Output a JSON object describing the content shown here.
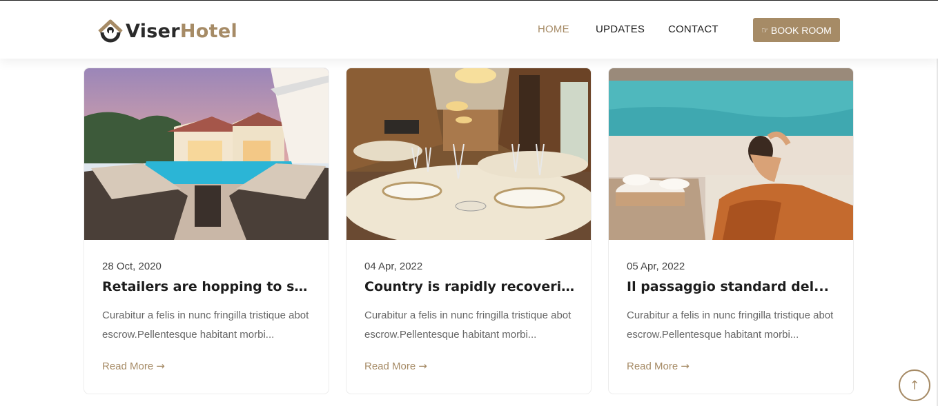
{
  "brand": {
    "name_part1": "Viser",
    "name_part2": "Hotel",
    "accent_color": "#a68b66"
  },
  "nav": {
    "items": [
      {
        "label": "HOME",
        "active": true
      },
      {
        "label": "UPDATES",
        "active": false
      },
      {
        "label": "CONTACT",
        "active": false
      }
    ],
    "book_button": {
      "icon": "hand-point-right-icon",
      "label": "BOOK ROOM"
    }
  },
  "posts": [
    {
      "image": "pool-villa-photo",
      "date": "28 Oct, 2020",
      "title": "Retailers are hopping to see ...",
      "excerpt": "Curabitur a felis in nunc fringilla tristique abot escrow.Pellentesque habitant morbi...",
      "read_more": "Read More",
      "arrow": "→"
    },
    {
      "image": "restaurant-dining-photo",
      "date": "04 Apr, 2022",
      "title": "Country is rapidly recovering...",
      "excerpt": "Curabitur a felis in nunc fringilla tristique abot escrow.Pellentesque habitant morbi...",
      "read_more": "Read More",
      "arrow": "→"
    },
    {
      "image": "poolside-breakfast-photo",
      "date": "05 Apr, 2022",
      "title": "Il passaggio standard del...",
      "excerpt": "Curabitur a felis in nunc fringilla tristique abot escrow.Pellentesque habitant morbi...",
      "read_more": "Read More",
      "arrow": "→"
    }
  ],
  "scroll_top": {
    "icon": "arrow-up-icon",
    "glyph": "↑"
  }
}
